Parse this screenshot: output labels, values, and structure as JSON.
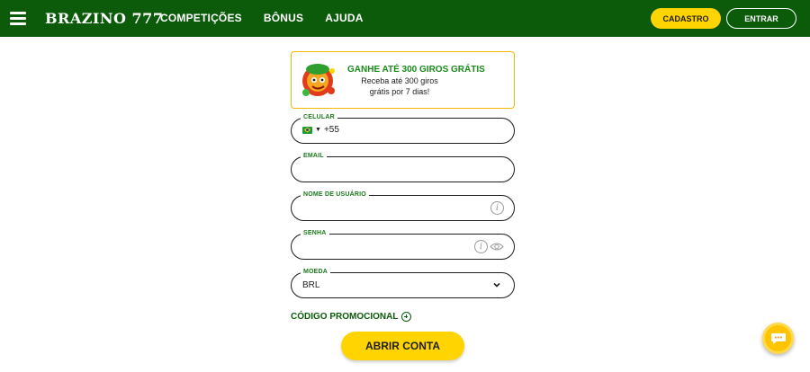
{
  "header": {
    "logo": "BRAZINO 777",
    "nav": [
      "COMPETIÇÕES",
      "BÔNUS",
      "AJUDA"
    ],
    "signup_label": "CADASTRO",
    "login_label": "ENTRAR"
  },
  "promo": {
    "title": "GANHE ATÉ 300 GIROS GRÁTIS",
    "subtitle": "Receba até 300 giros grátis por 7 dias!"
  },
  "form": {
    "phone": {
      "label": "CELULAR",
      "dial_code": "+55",
      "value": ""
    },
    "email": {
      "label": "EMAIL",
      "value": ""
    },
    "username": {
      "label": "NOME DE USUÁRIO",
      "value": ""
    },
    "password": {
      "label": "SENHA",
      "value": ""
    },
    "currency": {
      "label": "MOEDA",
      "value": "BRL"
    },
    "promo_code_label": "CÓDIGO PROMOCIONAL",
    "submit_label": "ABRIR CONTA"
  },
  "colors": {
    "brand_green": "#0b5b0b",
    "accent_yellow": "#ffd400",
    "label_green": "#1a7a1a"
  }
}
